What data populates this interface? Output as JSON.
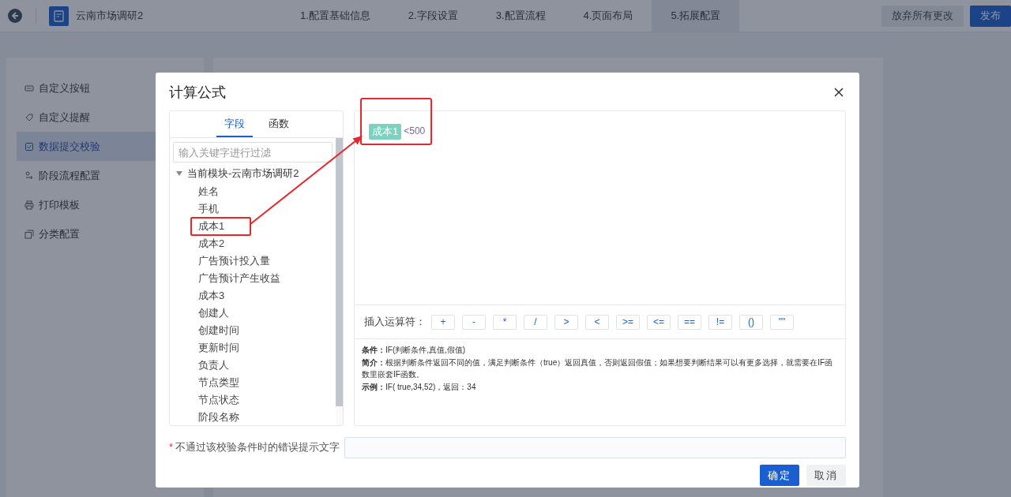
{
  "top_bar": {
    "app_title": "云南市场调研2",
    "steps": [
      {
        "label": "1.配置基础信息",
        "selected": false
      },
      {
        "label": "2.字段设置",
        "selected": false
      },
      {
        "label": "3.配置流程",
        "selected": false
      },
      {
        "label": "4.页面布局",
        "selected": false
      },
      {
        "label": "5.拓展配置",
        "selected": true
      }
    ],
    "buttons": [
      {
        "label": "放弃所有更改",
        "kind": "secondary"
      },
      {
        "label": "发布",
        "kind": "primary"
      }
    ]
  },
  "sidebar": {
    "items": [
      {
        "label": "自定义按钮",
        "selected": false
      },
      {
        "label": "自定义提醒",
        "selected": false
      },
      {
        "label": "数据提交校验",
        "selected": true
      },
      {
        "label": "阶段流程配置",
        "selected": false
      },
      {
        "label": "打印模板",
        "selected": false
      },
      {
        "label": "分类配置",
        "selected": false
      }
    ]
  },
  "dialog": {
    "title": "计算公式",
    "tabs": [
      {
        "label": "字段",
        "selected": true
      },
      {
        "label": "函数",
        "selected": false
      }
    ],
    "filter": {
      "placeholder": "输入关键字进行过滤"
    },
    "tree": {
      "label": "当前模块-云南市场调研2",
      "expanded": true,
      "children": [
        {
          "label": "姓名",
          "highlighted": false
        },
        {
          "label": "手机",
          "highlighted": false
        },
        {
          "label": "成本1",
          "highlighted": true
        },
        {
          "label": "成本2",
          "highlighted": false
        },
        {
          "label": "广告预计投入量",
          "highlighted": false
        },
        {
          "label": "广告预计产生收益",
          "highlighted": false
        },
        {
          "label": "成本3",
          "highlighted": false
        },
        {
          "label": "创建人",
          "highlighted": false
        },
        {
          "label": "创建时间",
          "highlighted": false
        },
        {
          "label": "更新时间",
          "highlighted": false
        },
        {
          "label": "负责人",
          "highlighted": false
        },
        {
          "label": "节点类型",
          "highlighted": false
        },
        {
          "label": "节点状态",
          "highlighted": false
        },
        {
          "label": "阶段名称",
          "highlighted": false
        }
      ]
    },
    "formula": {
      "highlighted": true,
      "tokens": [
        {
          "kind": "field",
          "text": "成本1"
        },
        {
          "kind": "text",
          "text": "<500"
        }
      ]
    },
    "operators_label": "插入运算符：",
    "operators": [
      "+",
      "-",
      "*",
      "/",
      ">",
      "<",
      ">=",
      "<=",
      "==",
      "!=",
      "()",
      "\"\""
    ],
    "help": [
      "**条件：**IF(判断条件,真值,假值)",
      "**简介：**根据判断条件返回不同的值，满足判断条件（true）返回真值，否则返回假值；如果想要判断结果可以有更多选择，就需要在IF函数里嵌套IF函数。",
      "**示例：**IF( true,34,52)，返回：34"
    ],
    "error_field": {
      "required": true,
      "required_mark": "*",
      "label": "不通过该校验条件时的错误提示文字"
    },
    "buttons": [
      {
        "label": "确定",
        "kind": "primary"
      },
      {
        "label": "取消",
        "kind": "secondary"
      }
    ]
  }
}
